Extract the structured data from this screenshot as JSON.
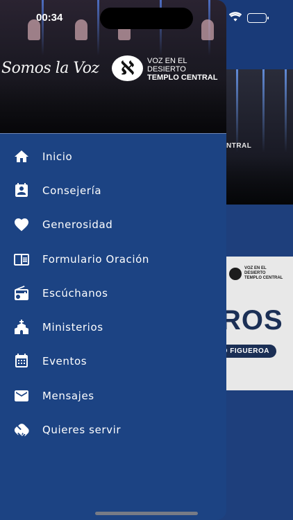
{
  "status_bar": {
    "time": "00:34"
  },
  "drawer": {
    "header": {
      "script_text": "Somos la Voz",
      "logo_glyph": "ℵ",
      "logo_line1": "VOZ EN EL",
      "logo_line2": "DESIERTO",
      "logo_line3": "TEMPLO CENTRAL"
    },
    "menu": [
      {
        "label": "Inicio",
        "icon": "home-icon"
      },
      {
        "label": "Consejería",
        "icon": "contact-card-icon"
      },
      {
        "label": "Generosidad",
        "icon": "heart-icon"
      },
      {
        "label": "Formulario Oración",
        "icon": "form-icon"
      },
      {
        "label": "Escúchanos",
        "icon": "radio-icon"
      },
      {
        "label": "Ministerios",
        "icon": "church-icon"
      },
      {
        "label": "Eventos",
        "icon": "calendar-icon"
      },
      {
        "label": "Mensajes",
        "icon": "mail-icon"
      },
      {
        "label": "Quieres servir",
        "icon": "handshake-icon"
      }
    ]
  },
  "background": {
    "banner_caption": "NTRAL",
    "card": {
      "logo_line1": "VOZ EN EL",
      "logo_line2": "DESIERTO",
      "logo_line3": "TEMPLO CENTRAL",
      "big_text": "ROS",
      "pill_text": "O FIGUEROA"
    }
  },
  "colors": {
    "drawer_bg": "#1c4383",
    "page_bg": "#1e3f7c",
    "text": "#ffffff"
  }
}
